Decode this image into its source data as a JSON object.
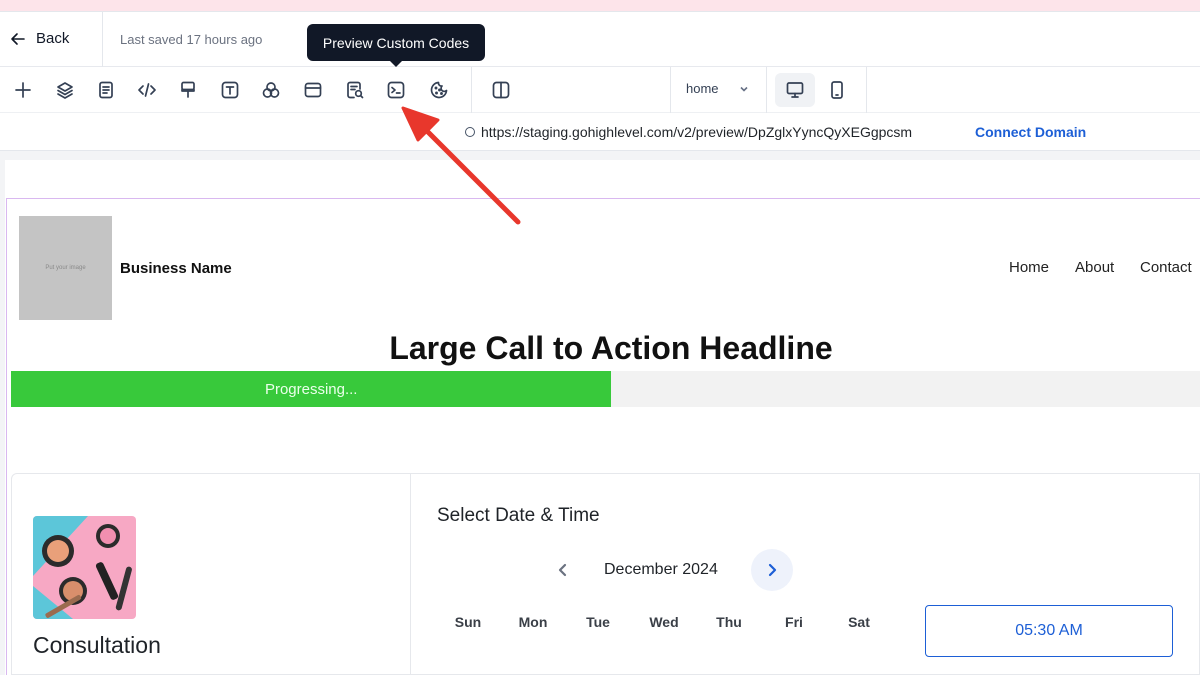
{
  "header": {
    "back_label": "Back",
    "saved_text": "Last saved 17 hours ago",
    "tooltip": "Preview Custom Codes"
  },
  "toolbar": {
    "icons": [
      "plus-icon",
      "layers-icon",
      "page-icon",
      "code-icon",
      "paint-brush-icon",
      "text-icon",
      "elements-icon",
      "section-icon",
      "search-page-icon",
      "terminal-icon",
      "cookie-icon",
      "split-view-icon"
    ],
    "page_select": "home",
    "devices": [
      "desktop-icon",
      "mobile-icon"
    ],
    "active_device": "desktop"
  },
  "urlbar": {
    "url": "https://staging.gohighlevel.com/v2/preview/DpZglxYyncQyXEGgpcsm",
    "connect_label": "Connect Domain"
  },
  "site": {
    "logo_placeholder": "Put your image",
    "business_name": "Business Name",
    "nav": [
      "Home",
      "About",
      "Contact"
    ],
    "headline": "Large Call to Action Headline",
    "progress_label": "Progressing...",
    "progress_value": 0.505
  },
  "booking": {
    "service": "Consultation",
    "title": "Select Date & Time",
    "month": "December 2024",
    "days": [
      "Sun",
      "Mon",
      "Tue",
      "Wed",
      "Thu",
      "Fri",
      "Sat"
    ],
    "time_slot": "05:30 AM"
  },
  "colors": {
    "accent": "#1d5fd6",
    "progress": "#38c93b",
    "annotation_arrow": "#e8372c"
  }
}
